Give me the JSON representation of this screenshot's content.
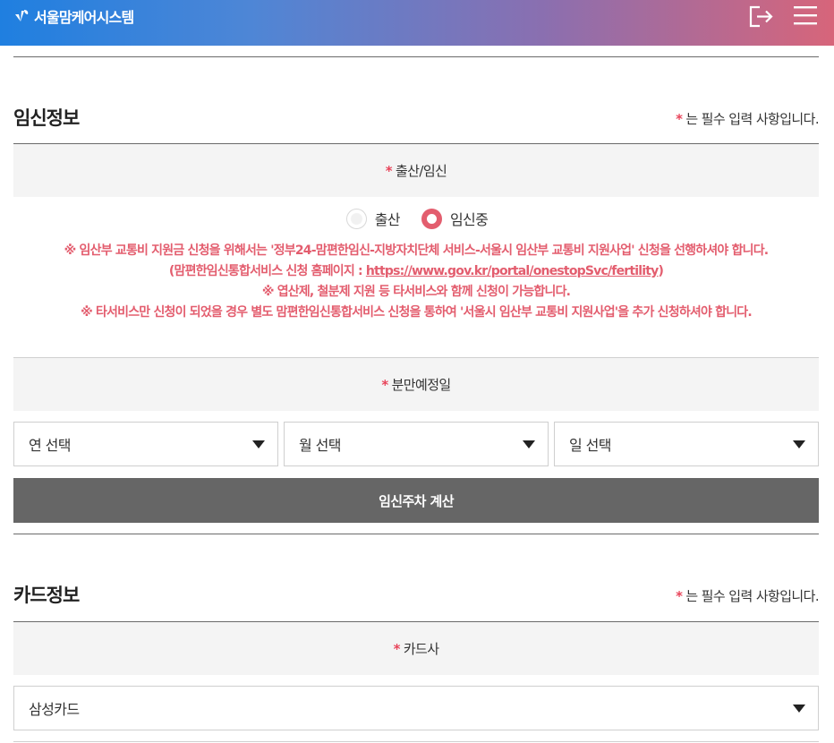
{
  "header": {
    "logo_text": "서울맘케어시스템",
    "logo_icon": "sprout-icon",
    "logout_icon": "logout-icon",
    "menu_icon": "hamburger-menu-icon",
    "gradient_colors": [
      "#1f7fe0",
      "#8a6fb0",
      "#d7657a"
    ]
  },
  "pregnancy_section": {
    "title": "임신정보",
    "required_star": "*",
    "required_note": "는 필수 입력 사항입니다.",
    "birth_status_label": "출산/임신",
    "radio_options": [
      {
        "label": "출산",
        "selected": false
      },
      {
        "label": "임신중",
        "selected": true
      }
    ],
    "notice": {
      "line1": "※ 임산부 교통비 지원금 신청을 위해서는 '정부24-맘편한임신-지방자치단체 서비스-서울시 임산부 교통비 지원사업' 신청을 선행하셔야 합니다.",
      "line2_prefix": "(맘편한임신통합서비스 신청 홈페이지 : ",
      "line2_link": "https://www.gov.kr/portal/onestopSvc/fertility",
      "line2_suffix": ")",
      "line3": "※ 엽산제, 철분제 지원 등 타서비스와 함께 신청이 가능합니다.",
      "line4": "※ 타서비스만 신청이 되었을 경우 별도 맘편한임신통합서비스 신청을 통하여 '서울시 임산부 교통비 지원사업'을 추가 신청하셔야 합니다."
    },
    "due_date_label": "분만예정일",
    "year_select": "연 선택",
    "month_select": "월 선택",
    "day_select": "일 선택",
    "calc_button": "임신주차 계산"
  },
  "card_section": {
    "title": "카드정보",
    "required_star": "*",
    "required_note": "는 필수 입력 사항입니다.",
    "card_company_label": "카드사",
    "card_company_value": "삼성카드"
  },
  "colors": {
    "accent_red": "#e35d6e",
    "required_star": "#e8445a",
    "calc_button_bg": "#666666",
    "label_bar_bg": "#f4f4f4"
  }
}
